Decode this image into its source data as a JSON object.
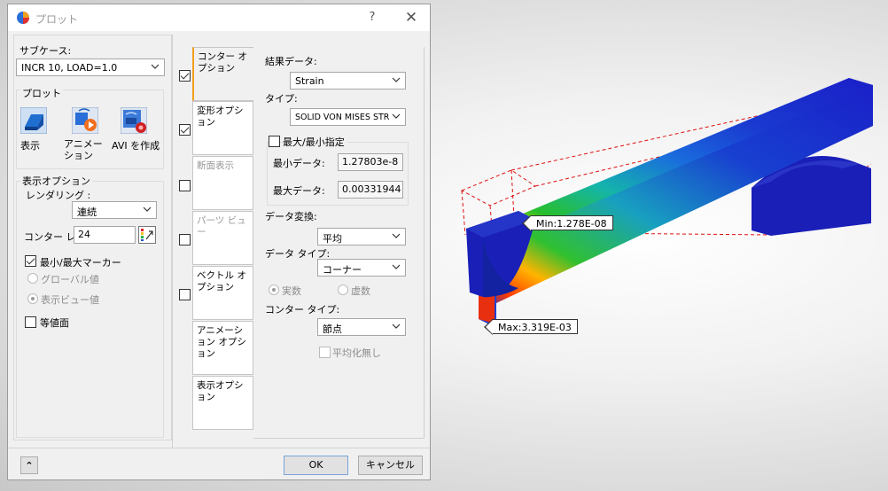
{
  "viewport": {
    "min_label": "Min:1.278E-08",
    "max_label": "Max:3.319E-03"
  },
  "dialog": {
    "title": "プロット",
    "help": "?",
    "close": "✕",
    "left": {
      "subcase_label": "サブケース:",
      "subcase_value": "INCR 10, LOAD=1.0",
      "plot_group_label": "プロット",
      "plot_buttons": [
        "表示",
        "アニメーション",
        "AVI を作成"
      ],
      "display_options_label": "表示オプション",
      "rendering_label": "レンダリング :",
      "rendering_value": "連続",
      "contour_label": "コンター レ",
      "contour_value": "24",
      "minmax_marker_label": "最小/最大マーカー",
      "global_label": "グローバル値",
      "view_label": "表示ビュー値",
      "isosurface_label": "等値面"
    },
    "tabs": [
      {
        "label": "コンター オプション",
        "checked": true,
        "has_checkbox": true
      },
      {
        "label": "変形オプション",
        "checked": true,
        "has_checkbox": true
      },
      {
        "label": "断面表示",
        "checked": false,
        "has_checkbox": true
      },
      {
        "label": "パーツ ビュー",
        "checked": false,
        "has_checkbox": true
      },
      {
        "label": "ベクトル オプション",
        "checked": false,
        "has_checkbox": true
      },
      {
        "label": "アニメーション オプション",
        "has_checkbox": false
      },
      {
        "label": "表示オプション",
        "has_checkbox": false
      }
    ],
    "contour": {
      "result_label": "結果データ:",
      "result_value": "Strain",
      "type_label": "タイプ:",
      "type_value": "SOLID VON MISES STR",
      "minmax_specify_label": "最大/最小指定",
      "min_data_label": "最小データ:",
      "min_data_value": "1.27803e-8",
      "max_data_label": "最大データ:",
      "max_data_value": "0.00331944",
      "transform_label": "データ変換:",
      "transform_value": "平均",
      "datatype_label": "データ タイプ:",
      "datatype_value": "コーナー",
      "real_label": "実数",
      "imag_label": "虚数",
      "contour_type_label": "コンター タイプ:",
      "contour_type_value": "節点",
      "no_average_label": "平均化無し"
    },
    "footer": {
      "expand": "⌃",
      "ok": "OK",
      "cancel": "キャンセル"
    }
  }
}
